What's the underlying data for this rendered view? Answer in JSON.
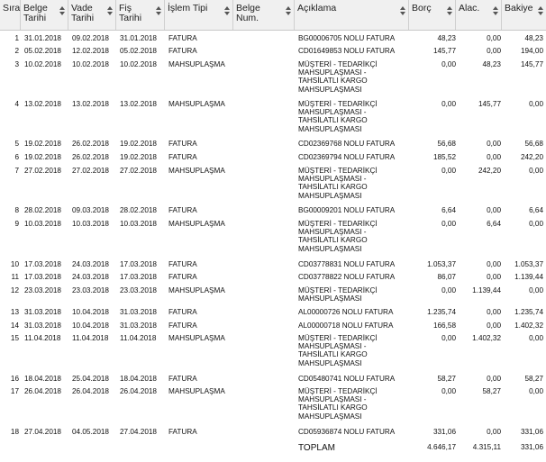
{
  "columns": [
    {
      "key": "sira",
      "label": "Sıra"
    },
    {
      "key": "belge_tarihi",
      "label": "Belge Tarihi"
    },
    {
      "key": "vade_tarihi",
      "label": "Vade Tarihi"
    },
    {
      "key": "fis_tarihi",
      "label": "Fiş Tarihi"
    },
    {
      "key": "islem_tipi",
      "label": "İşlem Tipi"
    },
    {
      "key": "belge_num",
      "label": "Belge Num."
    },
    {
      "key": "aciklama",
      "label": "Açıklama"
    },
    {
      "key": "borc",
      "label": "Borç"
    },
    {
      "key": "alac",
      "label": "Alac."
    },
    {
      "key": "bakiye",
      "label": "Bakiye"
    }
  ],
  "rows": [
    {
      "sira": "1",
      "belge_tarihi": "31.01.2018",
      "vade_tarihi": "09.02.2018",
      "fis_tarihi": "31.01.2018",
      "islem_tipi": "FATURA",
      "belge_num": "",
      "aciklama": "BG00006705 NOLU FATURA",
      "borc": "48,23",
      "alac": "0,00",
      "bakiye": "48,23"
    },
    {
      "sira": "2",
      "belge_tarihi": "05.02.2018",
      "vade_tarihi": "12.02.2018",
      "fis_tarihi": "05.02.2018",
      "islem_tipi": "FATURA",
      "belge_num": "",
      "aciklama": "CD01649853 NOLU FATURA",
      "borc": "145,77",
      "alac": "0,00",
      "bakiye": "194,00"
    },
    {
      "sira": "3",
      "belge_tarihi": "10.02.2018",
      "vade_tarihi": "10.02.2018",
      "fis_tarihi": "10.02.2018",
      "islem_tipi": "MAHSUPLAŞMA",
      "belge_num": "",
      "aciklama": "MÜŞTERİ - TEDARİKÇİ MAHSUPLAŞMASI - TAHSİLATLI KARGO MAHSUPLAŞMASI",
      "borc": "0,00",
      "alac": "48,23",
      "bakiye": "145,77"
    },
    {
      "sira": "4",
      "belge_tarihi": "13.02.2018",
      "vade_tarihi": "13.02.2018",
      "fis_tarihi": "13.02.2018",
      "islem_tipi": "MAHSUPLAŞMA",
      "belge_num": "",
      "aciklama": "MÜŞTERİ - TEDARİKÇİ MAHSUPLAŞMASI - TAHSİLATLI KARGO MAHSUPLAŞMASI",
      "borc": "0,00",
      "alac": "145,77",
      "bakiye": "0,00"
    },
    {
      "sira": "5",
      "belge_tarihi": "19.02.2018",
      "vade_tarihi": "26.02.2018",
      "fis_tarihi": "19.02.2018",
      "islem_tipi": "FATURA",
      "belge_num": "",
      "aciklama": "CD02369768 NOLU FATURA",
      "borc": "56,68",
      "alac": "0,00",
      "bakiye": "56,68"
    },
    {
      "sira": "6",
      "belge_tarihi": "19.02.2018",
      "vade_tarihi": "26.02.2018",
      "fis_tarihi": "19.02.2018",
      "islem_tipi": "FATURA",
      "belge_num": "",
      "aciklama": "CD02369794 NOLU FATURA",
      "borc": "185,52",
      "alac": "0,00",
      "bakiye": "242,20"
    },
    {
      "sira": "7",
      "belge_tarihi": "27.02.2018",
      "vade_tarihi": "27.02.2018",
      "fis_tarihi": "27.02.2018",
      "islem_tipi": "MAHSUPLAŞMA",
      "belge_num": "",
      "aciklama": "MÜŞTERİ - TEDARİKÇİ MAHSUPLAŞMASI - TAHSİLATLI KARGO MAHSUPLAŞMASI",
      "borc": "0,00",
      "alac": "242,20",
      "bakiye": "0,00"
    },
    {
      "sira": "8",
      "belge_tarihi": "28.02.2018",
      "vade_tarihi": "09.03.2018",
      "fis_tarihi": "28.02.2018",
      "islem_tipi": "FATURA",
      "belge_num": "",
      "aciklama": "BG00009201 NOLU FATURA",
      "borc": "6,64",
      "alac": "0,00",
      "bakiye": "6,64"
    },
    {
      "sira": "9",
      "belge_tarihi": "10.03.2018",
      "vade_tarihi": "10.03.2018",
      "fis_tarihi": "10.03.2018",
      "islem_tipi": "MAHSUPLAŞMA",
      "belge_num": "",
      "aciklama": "MÜŞTERİ - TEDARİKÇİ MAHSUPLAŞMASI - TAHSİLATLI KARGO MAHSUPLAŞMASI",
      "borc": "0,00",
      "alac": "6,64",
      "bakiye": "0,00"
    },
    {
      "sira": "10",
      "belge_tarihi": "17.03.2018",
      "vade_tarihi": "24.03.2018",
      "fis_tarihi": "17.03.2018",
      "islem_tipi": "FATURA",
      "belge_num": "",
      "aciklama": "CD03778831 NOLU FATURA",
      "borc": "1.053,37",
      "alac": "0,00",
      "bakiye": "1.053,37"
    },
    {
      "sira": "11",
      "belge_tarihi": "17.03.2018",
      "vade_tarihi": "24.03.2018",
      "fis_tarihi": "17.03.2018",
      "islem_tipi": "FATURA",
      "belge_num": "",
      "aciklama": "CD03778822 NOLU FATURA",
      "borc": "86,07",
      "alac": "0,00",
      "bakiye": "1.139,44"
    },
    {
      "sira": "12",
      "belge_tarihi": "23.03.2018",
      "vade_tarihi": "23.03.2018",
      "fis_tarihi": "23.03.2018",
      "islem_tipi": "MAHSUPLAŞMA",
      "belge_num": "",
      "aciklama": "MÜŞTERİ - TEDARİKÇİ MAHSUPLAŞMASI",
      "borc": "0,00",
      "alac": "1.139,44",
      "bakiye": "0,00"
    },
    {
      "sira": "13",
      "belge_tarihi": "31.03.2018",
      "vade_tarihi": "10.04.2018",
      "fis_tarihi": "31.03.2018",
      "islem_tipi": "FATURA",
      "belge_num": "",
      "aciklama": "AL00000726 NOLU FATURA",
      "borc": "1.235,74",
      "alac": "0,00",
      "bakiye": "1.235,74"
    },
    {
      "sira": "14",
      "belge_tarihi": "31.03.2018",
      "vade_tarihi": "10.04.2018",
      "fis_tarihi": "31.03.2018",
      "islem_tipi": "FATURA",
      "belge_num": "",
      "aciklama": "AL00000718 NOLU FATURA",
      "borc": "166,58",
      "alac": "0,00",
      "bakiye": "1.402,32"
    },
    {
      "sira": "15",
      "belge_tarihi": "11.04.2018",
      "vade_tarihi": "11.04.2018",
      "fis_tarihi": "11.04.2018",
      "islem_tipi": "MAHSUPLAŞMA",
      "belge_num": "",
      "aciklama": "MÜŞTERİ - TEDARİKÇİ MAHSUPLAŞMASI - TAHSİLATLI KARGO MAHSUPLAŞMASI",
      "borc": "0,00",
      "alac": "1.402,32",
      "bakiye": "0,00"
    },
    {
      "sira": "16",
      "belge_tarihi": "18.04.2018",
      "vade_tarihi": "25.04.2018",
      "fis_tarihi": "18.04.2018",
      "islem_tipi": "FATURA",
      "belge_num": "",
      "aciklama": "CD05480741 NOLU FATURA",
      "borc": "58,27",
      "alac": "0,00",
      "bakiye": "58,27"
    },
    {
      "sira": "17",
      "belge_tarihi": "26.04.2018",
      "vade_tarihi": "26.04.2018",
      "fis_tarihi": "26.04.2018",
      "islem_tipi": "MAHSUPLAŞMA",
      "belge_num": "",
      "aciklama": "MÜŞTERİ - TEDARİKÇİ MAHSUPLAŞMASI - TAHSİLATLI KARGO MAHSUPLAŞMASI",
      "borc": "0,00",
      "alac": "58,27",
      "bakiye": "0,00"
    },
    {
      "sira": "18",
      "belge_tarihi": "27.04.2018",
      "vade_tarihi": "04.05.2018",
      "fis_tarihi": "27.04.2018",
      "islem_tipi": "FATURA",
      "belge_num": "",
      "aciklama": "CD05936874 NOLU FATURA",
      "borc": "331,06",
      "alac": "0,00",
      "bakiye": "331,06"
    }
  ],
  "totals": {
    "label": "TOPLAM",
    "borc": "4.646,17",
    "alac": "4.315,11",
    "bakiye": "331,06"
  }
}
